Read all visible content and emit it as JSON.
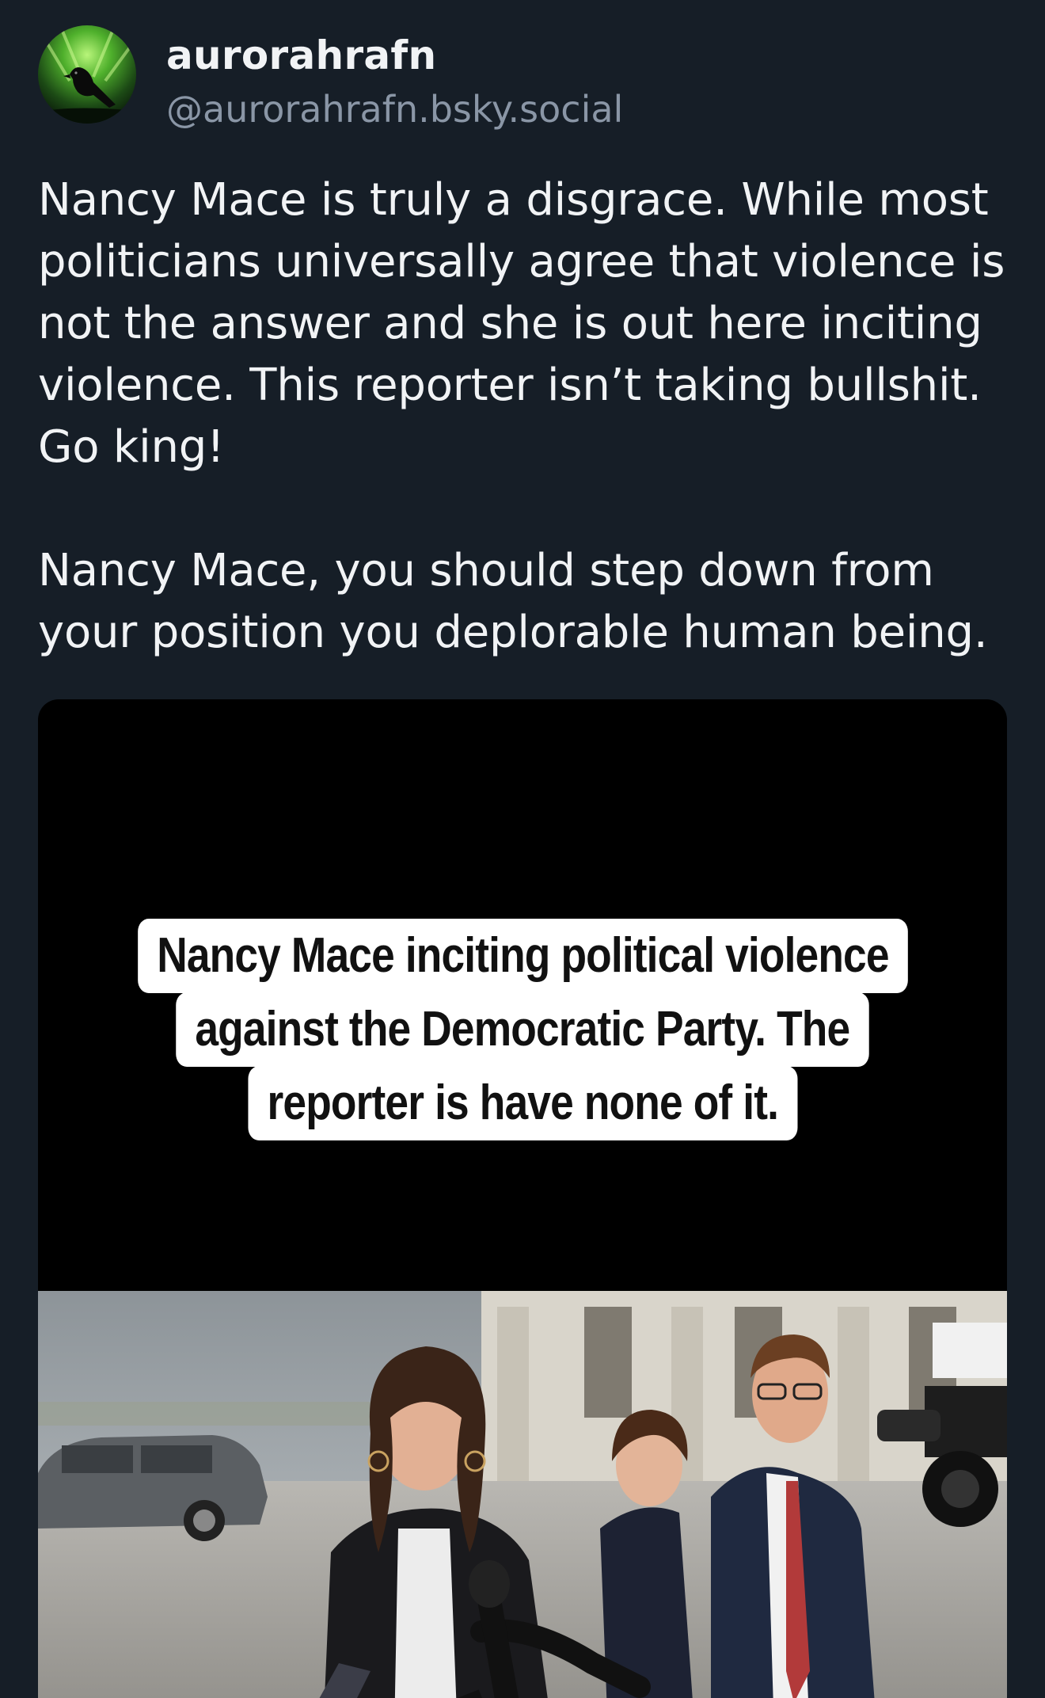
{
  "post": {
    "author": {
      "display_name": "aurorahrafn",
      "handle": "@aurorahrafn.bsky.social",
      "avatar_icon": "raven-aurora-avatar"
    },
    "text": "Nancy Mace is truly a disgrace. While most politicians universally agree that violence is not the answer and she is out here inciting violence. This reporter isn’t taking bullshit. Go king!\n\nNancy Mace, you should step down from your position you deplorable human being.",
    "media": {
      "type": "video",
      "caption_lines": [
        "Nancy Mace inciting political violence",
        "against the Democratic Party. The",
        "reporter is have none of it."
      ]
    }
  },
  "colors": {
    "background": "#161e27",
    "text_primary": "#f1f3f5",
    "text_secondary": "#8a96a6",
    "caption_bg": "#ffffff"
  }
}
